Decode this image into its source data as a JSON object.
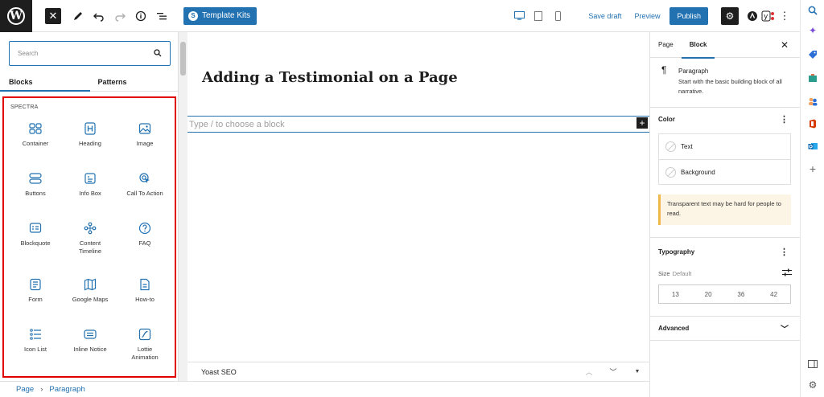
{
  "toolbar": {
    "template_kits_label": "Template Kits",
    "save_draft_label": "Save draft",
    "preview_label": "Preview",
    "publish_label": "Publish"
  },
  "inserter": {
    "search_placeholder": "Search",
    "tabs": [
      {
        "label": "Blocks",
        "active": true
      },
      {
        "label": "Patterns",
        "active": false
      }
    ],
    "category_title": "SPECTRA",
    "blocks": [
      {
        "label": "Container",
        "icon": "container-icon"
      },
      {
        "label": "Heading",
        "icon": "heading-icon"
      },
      {
        "label": "Image",
        "icon": "image-icon"
      },
      {
        "label": "Buttons",
        "icon": "buttons-icon"
      },
      {
        "label": "Info Box",
        "icon": "info-box-icon"
      },
      {
        "label": "Call To Action",
        "icon": "call-to-action-icon"
      },
      {
        "label": "Blockquote",
        "icon": "blockquote-icon"
      },
      {
        "label": "Content Timeline",
        "icon": "content-timeline-icon"
      },
      {
        "label": "FAQ",
        "icon": "faq-icon"
      },
      {
        "label": "Form",
        "icon": "form-icon"
      },
      {
        "label": "Google Maps",
        "icon": "google-maps-icon"
      },
      {
        "label": "How-to",
        "icon": "how-to-icon"
      },
      {
        "label": "Icon List",
        "icon": "icon-list-icon"
      },
      {
        "label": "Inline Notice",
        "icon": "inline-notice-icon"
      },
      {
        "label": "Lottie Animation",
        "icon": "lottie-animation-icon"
      }
    ],
    "highlight_color": "#e00000"
  },
  "canvas": {
    "post_title": "Adding a Testimonial on a Page",
    "paragraph_placeholder": "Type / to choose a block",
    "yoast_label": "Yoast SEO"
  },
  "sidebar": {
    "tabs": [
      {
        "label": "Page",
        "active": false
      },
      {
        "label": "Block",
        "active": true
      }
    ],
    "block_name": "Paragraph",
    "block_description": "Start with the basic building block of all narrative.",
    "color_title": "Color",
    "color_items": [
      "Text",
      "Background"
    ],
    "notice": "Transparent text may be hard for people to read.",
    "typography_title": "Typography",
    "size_label": "Size",
    "size_value": "Default",
    "size_presets": [
      "13",
      "20",
      "36",
      "42"
    ],
    "advanced_title": "Advanced"
  },
  "breadcrumb": {
    "items": [
      "Page",
      "Paragraph"
    ]
  },
  "colors": {
    "accent": "#2271b1",
    "dark": "#1e1e1e"
  }
}
